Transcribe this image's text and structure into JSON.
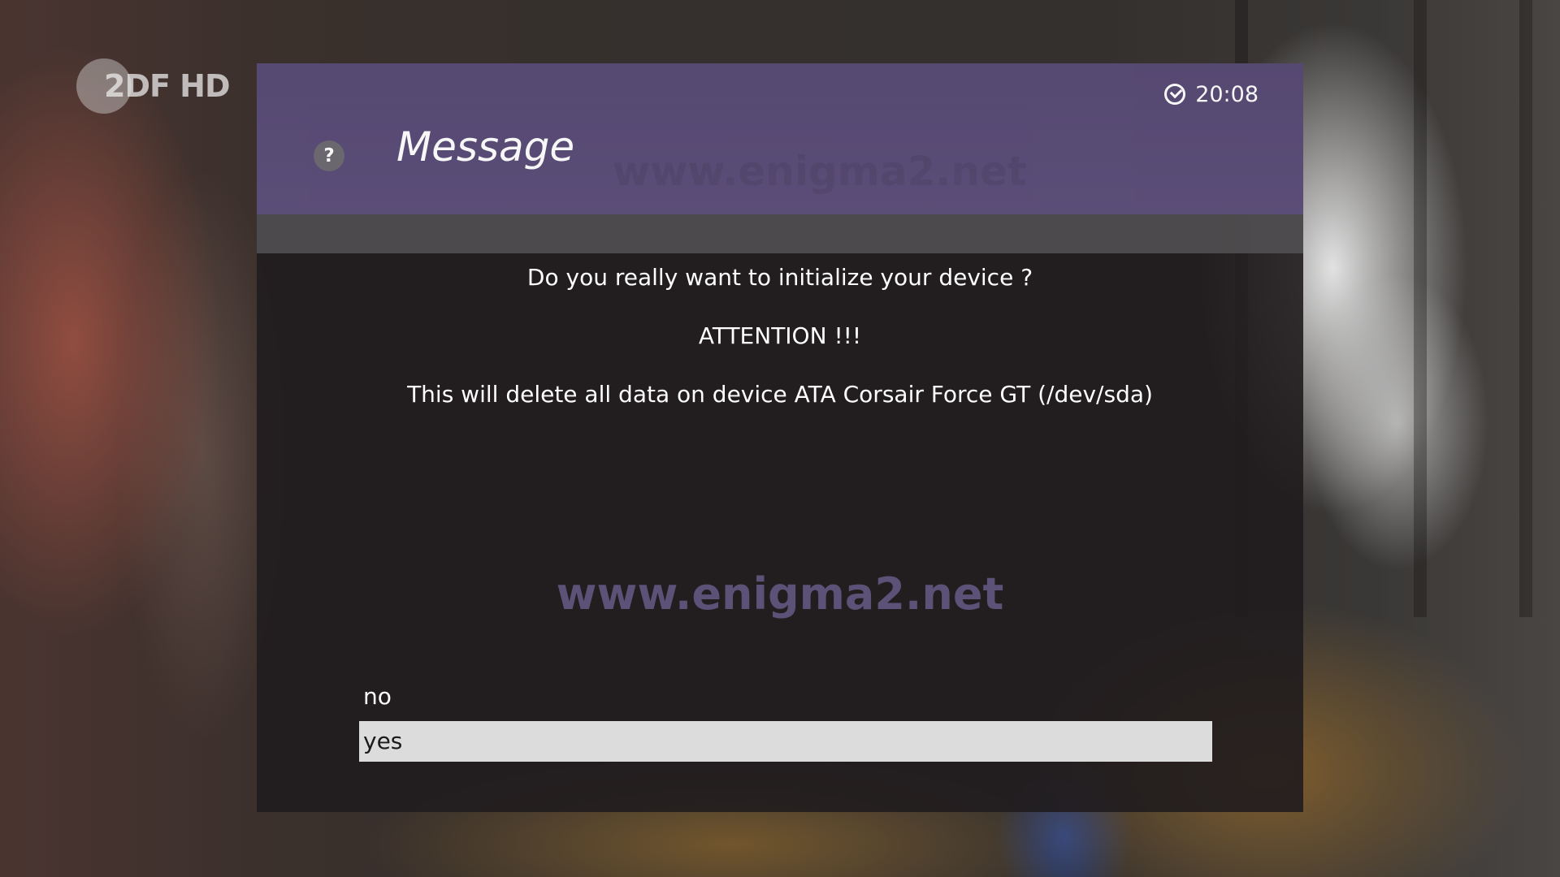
{
  "channel_logo": {
    "text": "2DF HD"
  },
  "dialog": {
    "title": "Message",
    "clock": "20:08",
    "watermark": "www.enigma2.net",
    "lines": [
      "Do you really want to initialize your device ?",
      "ATTENTION !!!",
      "This will delete all data on device ATA Corsair Force GT (/dev/sda)"
    ],
    "choices": [
      {
        "label": "no",
        "selected": false
      },
      {
        "label": "yes",
        "selected": true
      }
    ]
  },
  "colors": {
    "header": "#5c4f7a",
    "selected": "#dcdcdc",
    "watermark": "#60547c"
  },
  "icons": [
    "help-icon",
    "clock-icon"
  ]
}
